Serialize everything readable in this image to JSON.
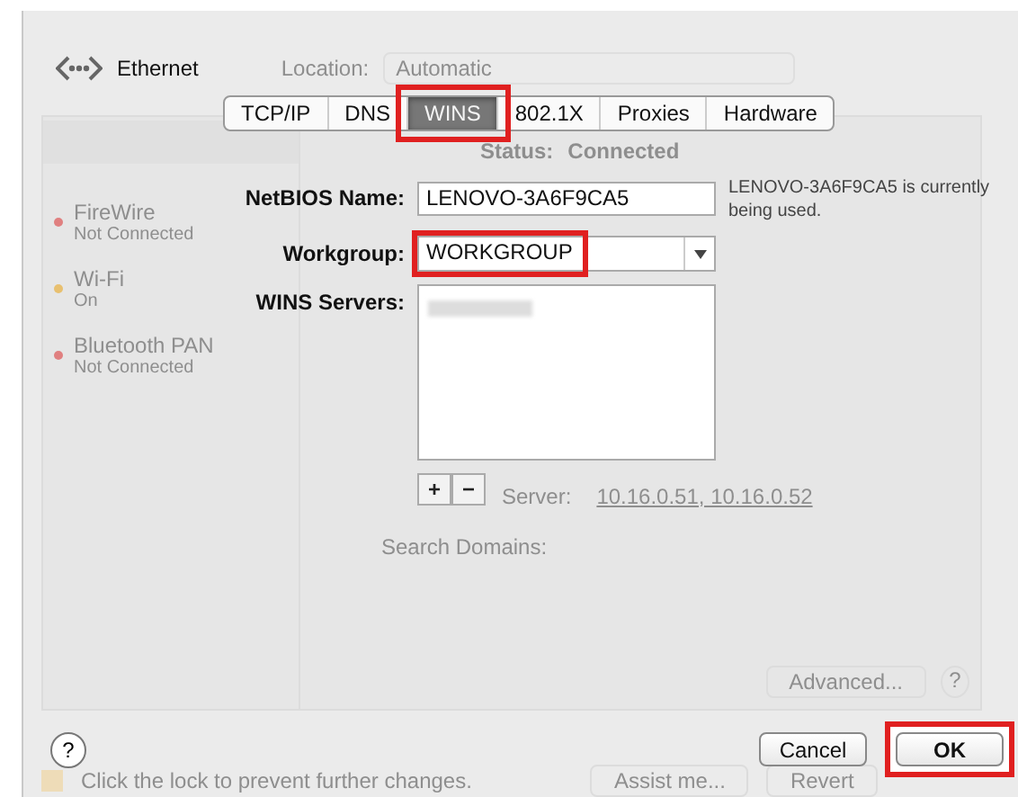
{
  "window": {
    "title": "Ethernet",
    "location_label": "Location:",
    "location_value": "Automatic"
  },
  "sidebar": {
    "items": [
      {
        "name": "FireWire",
        "status": "Not Connected",
        "color": "#e08080"
      },
      {
        "name": "Wi-Fi",
        "status": "On",
        "color": "#e8c070"
      },
      {
        "name": "Bluetooth PAN",
        "status": "Not Connected",
        "color": "#e08080"
      }
    ]
  },
  "details": {
    "status_label": "Status:",
    "status_value": "Connected",
    "server_label": "Server:",
    "server_value": "10.16.0.51, 10.16.0.52",
    "search_domains_label": "Search Domains:",
    "advanced_button": "Advanced...",
    "help": "?"
  },
  "footer": {
    "lock_text": "Click the lock to prevent further changes.",
    "assist_button": "Assist me...",
    "revert_button": "Revert"
  },
  "sheet": {
    "tabs": [
      {
        "label": "TCP/IP",
        "selected": false,
        "highlighted": false
      },
      {
        "label": "DNS",
        "selected": false,
        "highlighted": false
      },
      {
        "label": "WINS",
        "selected": true,
        "highlighted": true
      },
      {
        "label": "802.1X",
        "selected": false,
        "highlighted": false
      },
      {
        "label": "Proxies",
        "selected": false,
        "highlighted": false
      },
      {
        "label": "Hardware",
        "selected": false,
        "highlighted": false
      }
    ],
    "netbios": {
      "label": "NetBIOS Name:",
      "value": "LENOVO-3A6F9CA5",
      "note": "LENOVO-3A6F9CA5 is currently being used."
    },
    "workgroup": {
      "label": "Workgroup:",
      "value": "WORKGROUP",
      "highlighted": true
    },
    "wins_servers": {
      "label": "WINS Servers:",
      "add": "+",
      "remove": "−"
    },
    "help": "?",
    "buttons": [
      {
        "label": "Cancel",
        "kind": "cancel",
        "highlighted": false
      },
      {
        "label": "OK",
        "kind": "default",
        "highlighted": true
      }
    ]
  }
}
